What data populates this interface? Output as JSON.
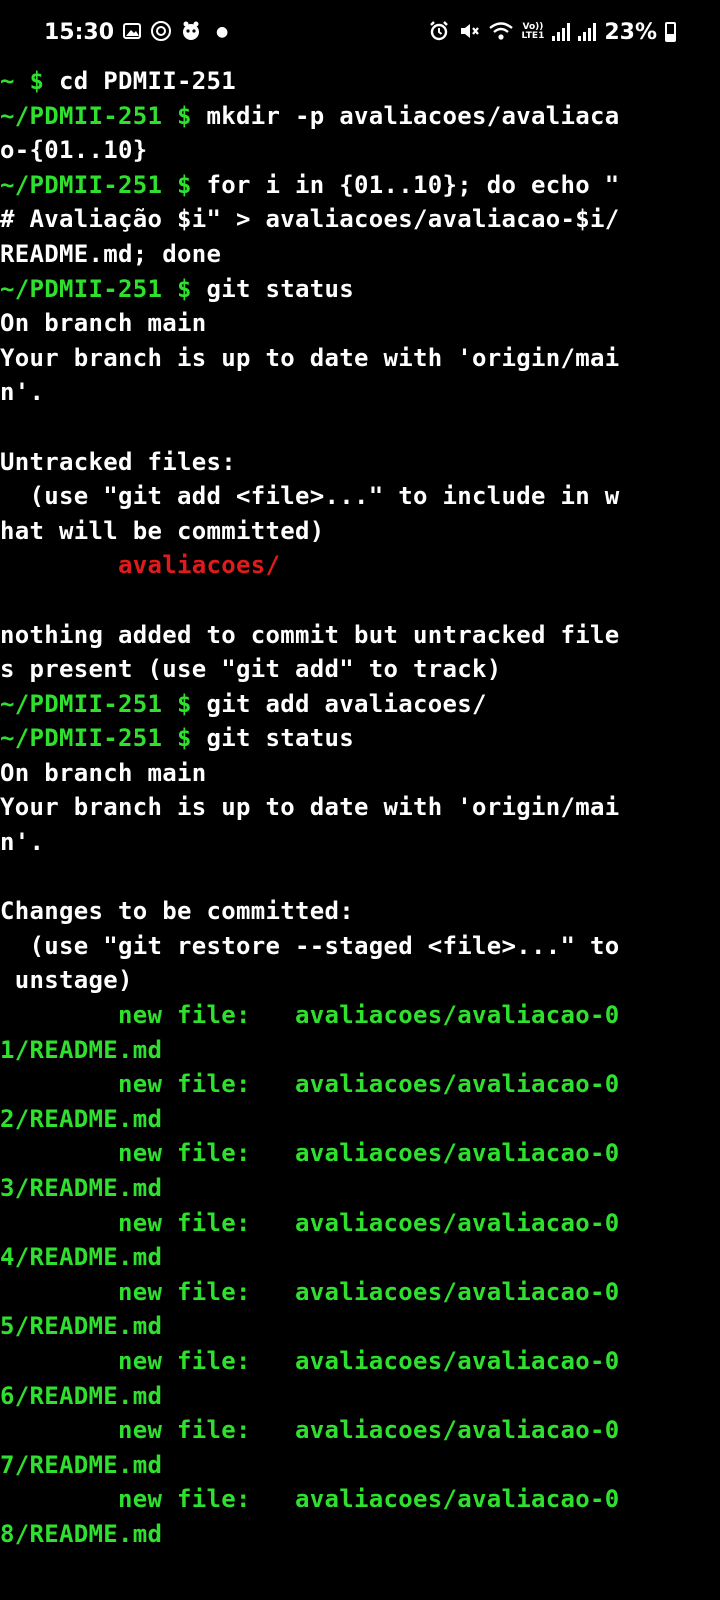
{
  "status_bar": {
    "time": "15:30",
    "battery_percent": "23%",
    "network_label_top": "Vo))",
    "network_label_bottom": "LTE1",
    "icons_left": [
      "gallery-icon",
      "pinwheel-icon",
      "assistant-icon",
      "dot-icon"
    ],
    "icons_right": [
      "alarm-icon",
      "mute-icon",
      "wifi-icon",
      "signal-icon",
      "signal-icon",
      "battery-icon"
    ]
  },
  "colors": {
    "background": "#000000",
    "prompt_green": "#2fe02f",
    "text_white": "#ffffff",
    "untracked_red": "#e01b1b"
  },
  "terminal": {
    "lines": [
      [
        {
          "t": "~ $ ",
          "c": "green"
        },
        {
          "t": "cd PDMII-251",
          "c": "white"
        }
      ],
      [
        {
          "t": "~/PDMII-251 $ ",
          "c": "green"
        },
        {
          "t": "mkdir -p avaliacoes/avaliaca",
          "c": "white"
        }
      ],
      [
        {
          "t": "o-{01..10}",
          "c": "white"
        }
      ],
      [
        {
          "t": "~/PDMII-251 $ ",
          "c": "green"
        },
        {
          "t": "for i in {01..10}; do echo \"",
          "c": "white"
        }
      ],
      [
        {
          "t": "# Avaliação $i\" > avaliacoes/avaliacao-$i/",
          "c": "white"
        }
      ],
      [
        {
          "t": "README.md; done",
          "c": "white"
        }
      ],
      [
        {
          "t": "~/PDMII-251 $ ",
          "c": "green"
        },
        {
          "t": "git status",
          "c": "white"
        }
      ],
      [
        {
          "t": "On branch main",
          "c": "white"
        }
      ],
      [
        {
          "t": "Your branch is up to date with 'origin/mai",
          "c": "white"
        }
      ],
      [
        {
          "t": "n'.",
          "c": "white"
        }
      ],
      [
        {
          "t": "",
          "c": "white"
        }
      ],
      [
        {
          "t": "Untracked files:",
          "c": "white"
        }
      ],
      [
        {
          "t": "  (use \"git add <file>...\" to include in w",
          "c": "white"
        }
      ],
      [
        {
          "t": "hat will be committed)",
          "c": "white"
        }
      ],
      [
        {
          "t": "        ",
          "c": "white"
        },
        {
          "t": "avaliacoes/",
          "c": "red"
        }
      ],
      [
        {
          "t": "",
          "c": "white"
        }
      ],
      [
        {
          "t": "nothing added to commit but untracked file",
          "c": "white"
        }
      ],
      [
        {
          "t": "s present (use \"git add\" to track)",
          "c": "white"
        }
      ],
      [
        {
          "t": "~/PDMII-251 $ ",
          "c": "green"
        },
        {
          "t": "git add avaliacoes/",
          "c": "white"
        }
      ],
      [
        {
          "t": "~/PDMII-251 $ ",
          "c": "green"
        },
        {
          "t": "git status",
          "c": "white"
        }
      ],
      [
        {
          "t": "On branch main",
          "c": "white"
        }
      ],
      [
        {
          "t": "Your branch is up to date with 'origin/mai",
          "c": "white"
        }
      ],
      [
        {
          "t": "n'.",
          "c": "white"
        }
      ],
      [
        {
          "t": "",
          "c": "white"
        }
      ],
      [
        {
          "t": "Changes to be committed:",
          "c": "white"
        }
      ],
      [
        {
          "t": "  (use \"git restore --staged <file>...\" to",
          "c": "white"
        }
      ],
      [
        {
          "t": " unstage)",
          "c": "white"
        }
      ],
      [
        {
          "t": "        new file:   avaliacoes/avaliacao-0",
          "c": "green"
        }
      ],
      [
        {
          "t": "1/README.md",
          "c": "green"
        }
      ],
      [
        {
          "t": "        new file:   avaliacoes/avaliacao-0",
          "c": "green"
        }
      ],
      [
        {
          "t": "2/README.md",
          "c": "green"
        }
      ],
      [
        {
          "t": "        new file:   avaliacoes/avaliacao-0",
          "c": "green"
        }
      ],
      [
        {
          "t": "3/README.md",
          "c": "green"
        }
      ],
      [
        {
          "t": "        new file:   avaliacoes/avaliacao-0",
          "c": "green"
        }
      ],
      [
        {
          "t": "4/README.md",
          "c": "green"
        }
      ],
      [
        {
          "t": "        new file:   avaliacoes/avaliacao-0",
          "c": "green"
        }
      ],
      [
        {
          "t": "5/README.md",
          "c": "green"
        }
      ],
      [
        {
          "t": "        new file:   avaliacoes/avaliacao-0",
          "c": "green"
        }
      ],
      [
        {
          "t": "6/README.md",
          "c": "green"
        }
      ],
      [
        {
          "t": "        new file:   avaliacoes/avaliacao-0",
          "c": "green"
        }
      ],
      [
        {
          "t": "7/README.md",
          "c": "green"
        }
      ],
      [
        {
          "t": "        new file:   avaliacoes/avaliacao-0",
          "c": "green"
        }
      ],
      [
        {
          "t": "8/README.md",
          "c": "green"
        }
      ]
    ]
  }
}
